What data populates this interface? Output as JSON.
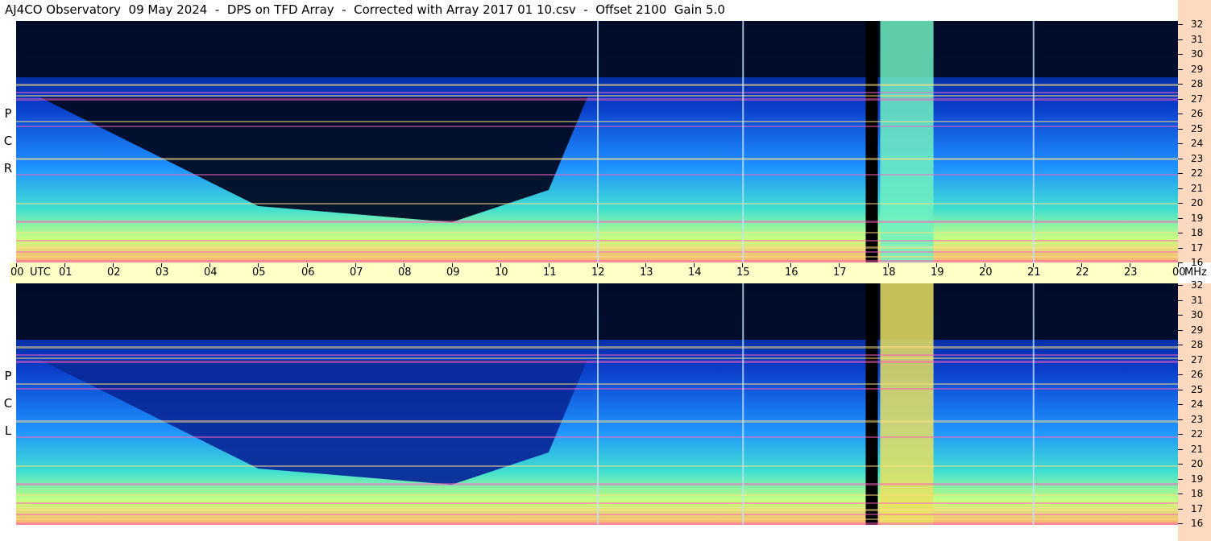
{
  "title": "AJ4CO Observatory  09 May 2024  -  DPS on TFD Array  -  Corrected with Array 2017 01 10.csv  -  Offset 2100  Gain 5.0",
  "panels": [
    {
      "label_letters": [
        "P",
        "C",
        "R"
      ]
    },
    {
      "label_letters": [
        "P",
        "C",
        "L"
      ]
    }
  ],
  "chart_data": {
    "type": "heatmap",
    "title": "AJ4CO Observatory  09 May 2024  -  DPS on TFD Array  -  Corrected with Array 2017 01 10.csv  -  Offset 2100  Gain 5.0",
    "x_axis": {
      "ticks": [
        "00",
        "01",
        "02",
        "03",
        "04",
        "05",
        "06",
        "07",
        "08",
        "09",
        "10",
        "11",
        "12",
        "13",
        "14",
        "15",
        "16",
        "17",
        "18",
        "19",
        "20",
        "21",
        "22",
        "23",
        "00"
      ],
      "utc_label": "UTC",
      "range_hours": [
        0,
        24
      ]
    },
    "y_axis": {
      "ticks": [
        32,
        31,
        30,
        29,
        28,
        27,
        26,
        25,
        24,
        23,
        22,
        21,
        20,
        19,
        18,
        17,
        16
      ],
      "unit": "MHz",
      "range": [
        16,
        32
      ]
    },
    "series": [
      {
        "name": "RCP"
      },
      {
        "name": "LCP"
      }
    ]
  }
}
